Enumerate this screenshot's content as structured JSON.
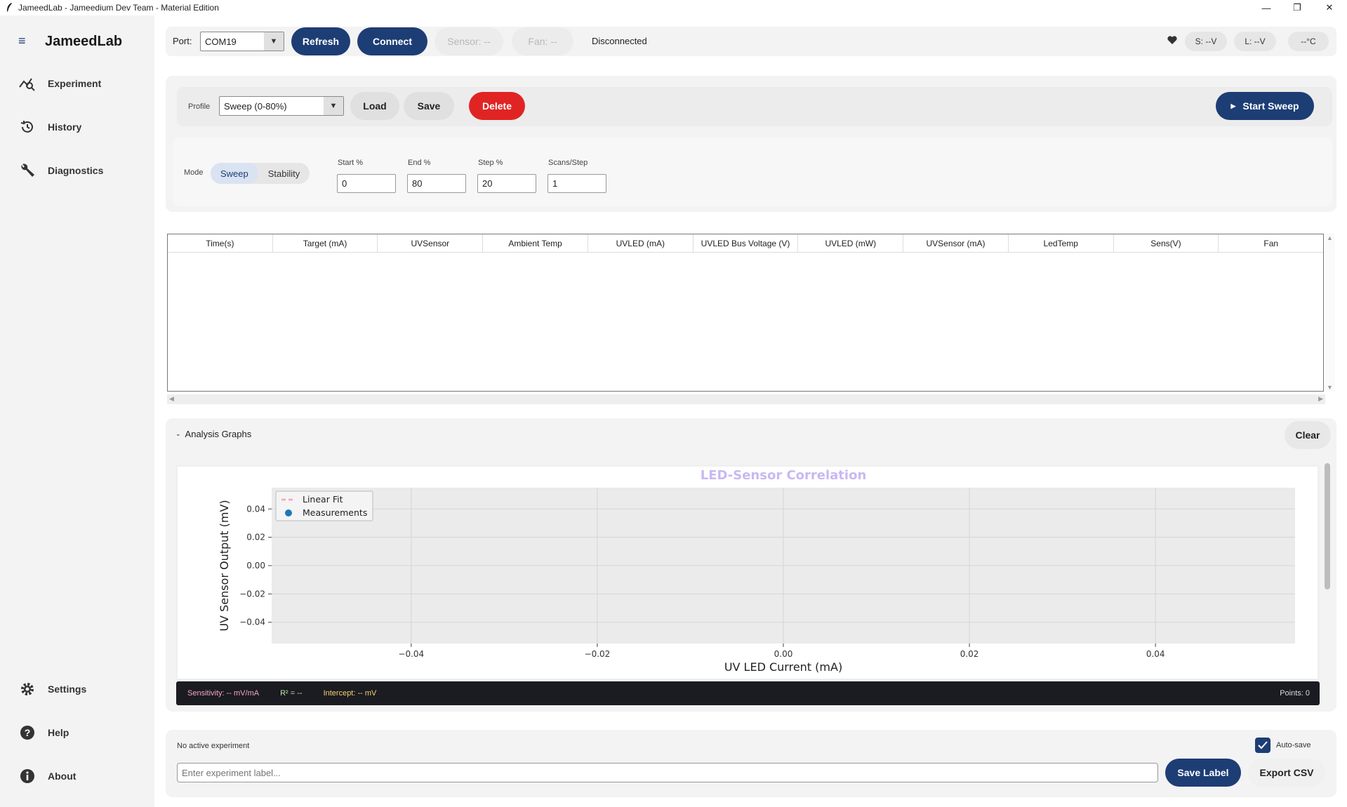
{
  "window": {
    "title": "JameedLab - Jameedium Dev Team - Material Edition",
    "controls": {
      "minimize": "—",
      "maximize": "❐",
      "close": "✕"
    }
  },
  "sidebar": {
    "menu_glyph": "≡",
    "brand": "JameedLab",
    "items": [
      {
        "label": "Experiment",
        "icon": "chart-magnify-icon"
      },
      {
        "label": "History",
        "icon": "history-icon"
      },
      {
        "label": "Diagnostics",
        "icon": "wrench-icon"
      }
    ],
    "bottom_items": [
      {
        "label": "Settings",
        "icon": "gear-icon"
      },
      {
        "label": "Help",
        "icon": "help-icon"
      },
      {
        "label": "About",
        "icon": "info-icon"
      }
    ]
  },
  "connection": {
    "port_label": "Port:",
    "port_value": "COM19",
    "refresh_label": "Refresh",
    "connect_label": "Connect",
    "sensor_label": "Sensor: --",
    "fan_label": "Fan: --",
    "status": "Disconnected",
    "s_voltage": "S: --V",
    "l_voltage": "L: --V",
    "temperature": "--°C"
  },
  "profile": {
    "label": "Profile",
    "value": "Sweep (0-80%)",
    "load_label": "Load",
    "save_label": "Save",
    "delete_label": "Delete",
    "start_label": "Start Sweep"
  },
  "params": {
    "mode_label": "Mode",
    "modes": [
      "Sweep",
      "Stability"
    ],
    "active_mode": "Sweep",
    "fields": [
      {
        "label": "Start %",
        "value": "0"
      },
      {
        "label": "End %",
        "value": "80"
      },
      {
        "label": "Step %",
        "value": "20"
      },
      {
        "label": "Scans/Step",
        "value": "1"
      }
    ]
  },
  "table": {
    "columns": [
      "Time(s)",
      "Target (mA)",
      "UVSensor",
      "Ambient Temp",
      "UVLED (mA)",
      "UVLED Bus Voltage (V)",
      "UVLED (mW)",
      "UVSensor (mA)",
      "LedTemp",
      "Sens(V)",
      "Fan"
    ],
    "rows": []
  },
  "analysis": {
    "header": "Analysis Graphs",
    "clear_label": "Clear",
    "sensitivity": "Sensitivity: -- mV/mA",
    "r2": "R² = --",
    "intercept": "Intercept: -- mV",
    "points": "Points: 0",
    "colors": {
      "sensitivity": "#f5a3c7",
      "r2": "#b9e8a0",
      "intercept": "#f5d36a"
    }
  },
  "chart_data": {
    "type": "scatter",
    "title": "LED-Sensor Correlation",
    "xlabel": "UV LED Current (mA)",
    "ylabel": "UV Sensor Output (mV)",
    "xlim": [
      -0.055,
      0.055
    ],
    "ylim": [
      -0.055,
      0.055
    ],
    "xticks": [
      -0.04,
      -0.02,
      0.0,
      0.02,
      0.04
    ],
    "xtick_labels": [
      "−0.04",
      "−0.02",
      "0.00",
      "0.02",
      "0.04"
    ],
    "yticks": [
      0.04,
      0.02,
      0.0,
      -0.02,
      -0.04
    ],
    "ytick_labels": [
      "0.04",
      "0.02",
      "0.00",
      "−0.02",
      "−0.04"
    ],
    "grid": true,
    "legend_position": "top-left",
    "series": [
      {
        "name": "Linear Fit",
        "style": "dashed-line",
        "color": "#f4a6b8",
        "x": [],
        "y": []
      },
      {
        "name": "Measurements",
        "style": "marker",
        "color": "#1f77b4",
        "x": [],
        "y": []
      }
    ]
  },
  "footer": {
    "status": "No active experiment",
    "autosave_label": "Auto-save",
    "autosave_checked": true,
    "label_placeholder": "Enter experiment label...",
    "save_label": "Save Label",
    "export_label": "Export CSV"
  }
}
